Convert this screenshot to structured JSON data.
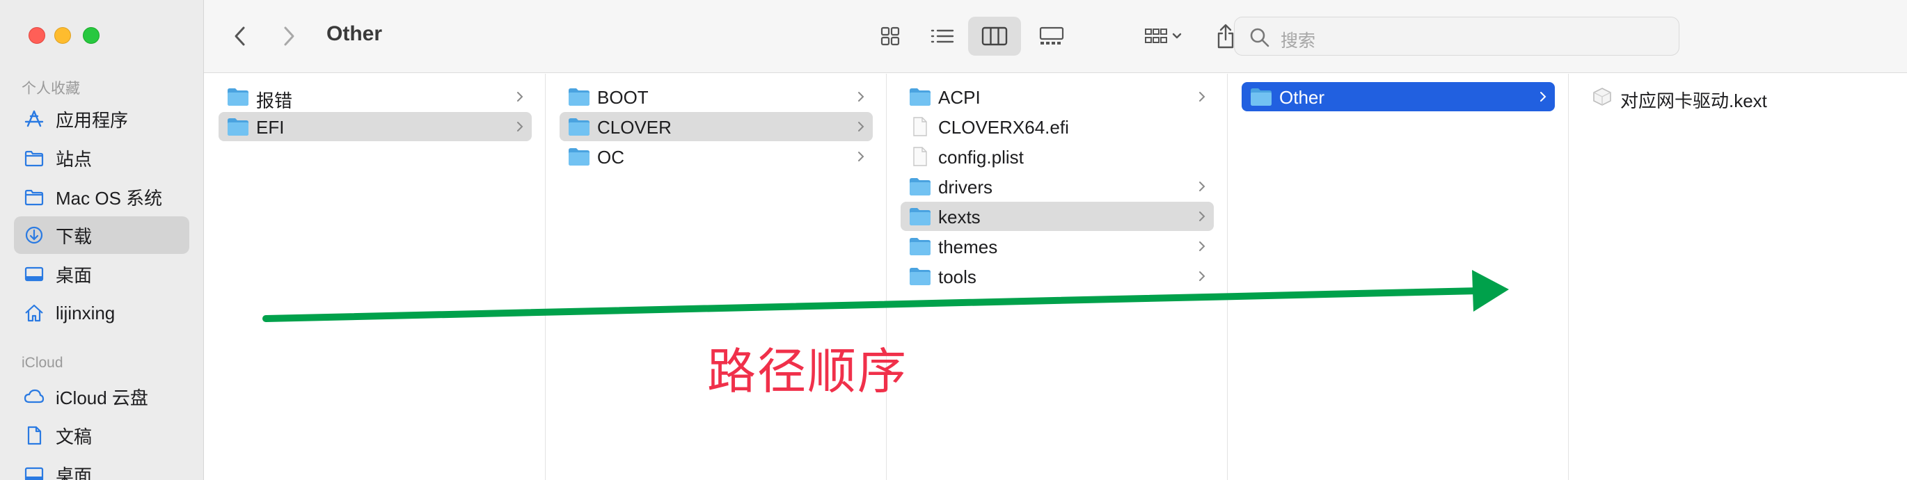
{
  "window": {
    "title": "Other"
  },
  "sidebar": {
    "favorites_header": "个人收藏",
    "icloud_header": "iCloud",
    "items": [
      {
        "label": "应用程序",
        "icon": "apps-icon"
      },
      {
        "label": "站点",
        "icon": "folder-icon"
      },
      {
        "label": "Mac OS 系统",
        "icon": "folder-icon"
      },
      {
        "label": "下载",
        "icon": "download-icon",
        "selected": true
      },
      {
        "label": "桌面",
        "icon": "desktop-icon"
      },
      {
        "label": "lijinxing",
        "icon": "home-icon"
      },
      {
        "label": "iCloud 云盘",
        "icon": "cloud-icon"
      },
      {
        "label": "文稿",
        "icon": "document-icon"
      },
      {
        "label": "桌面",
        "icon": "desktop-icon"
      }
    ]
  },
  "toolbar": {
    "search_placeholder": "搜索"
  },
  "columns": [
    {
      "items": [
        {
          "label": "报错",
          "type": "folder",
          "chevron": true
        },
        {
          "label": "EFI",
          "type": "folder",
          "chevron": true,
          "selected": "gray"
        }
      ]
    },
    {
      "items": [
        {
          "label": "BOOT",
          "type": "folder",
          "chevron": true
        },
        {
          "label": "CLOVER",
          "type": "folder",
          "chevron": true,
          "selected": "gray"
        },
        {
          "label": "OC",
          "type": "folder",
          "chevron": true
        }
      ]
    },
    {
      "items": [
        {
          "label": "ACPI",
          "type": "folder",
          "chevron": true
        },
        {
          "label": "CLOVERX64.efi",
          "type": "file",
          "chevron": false
        },
        {
          "label": "config.plist",
          "type": "file",
          "chevron": false
        },
        {
          "label": "drivers",
          "type": "folder",
          "chevron": true
        },
        {
          "label": "kexts",
          "type": "folder",
          "chevron": true,
          "selected": "gray"
        },
        {
          "label": "themes",
          "type": "folder",
          "chevron": true
        },
        {
          "label": "tools",
          "type": "folder",
          "chevron": true
        }
      ]
    },
    {
      "items": [
        {
          "label": "Other",
          "type": "folder",
          "chevron": true,
          "selected": "blue"
        }
      ]
    },
    {
      "items": [
        {
          "label": "对应网卡驱动.kext",
          "type": "kext",
          "chevron": false
        }
      ]
    }
  ],
  "annotation": {
    "text": "路径顺序",
    "color": "#f0304a",
    "arrow_color": "#00a14b"
  },
  "colors": {
    "selection_blue": "#2160e0",
    "folder_blue": "#5ab4ec"
  }
}
